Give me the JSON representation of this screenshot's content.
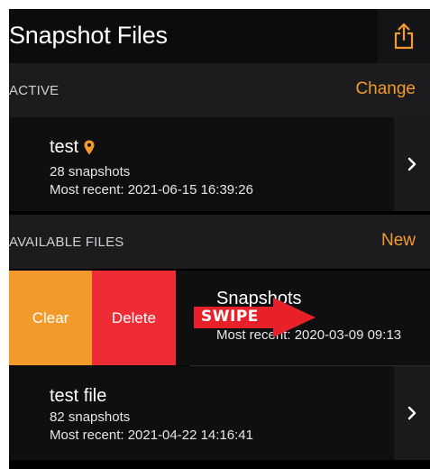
{
  "nav": {
    "title": "Snapshot Files",
    "share_icon": "share-icon"
  },
  "active_section": {
    "header": "ACTIVE",
    "action": "Change",
    "file": {
      "name": "test",
      "count": "28 snapshots",
      "recent": "Most recent: 2021-06-15 16:39:26"
    }
  },
  "available_section": {
    "header": "AVAILABLE FILES",
    "action": "New",
    "files": [
      {
        "name": "Snapshots",
        "recent": "Most recent: 2020-03-09 09:13",
        "actions": {
          "clear": "Clear",
          "delete": "Delete"
        },
        "overlay": "SWIPE"
      },
      {
        "name": "test file",
        "count": "82 snapshots",
        "recent": "Most recent: 2021-04-22 14:16:41"
      }
    ]
  },
  "colors": {
    "accent": "#f29a2e",
    "delete": "#ef2b35",
    "clear": "#f39a2b",
    "background": "#000000",
    "swipe_arrow": "#e8202a"
  }
}
